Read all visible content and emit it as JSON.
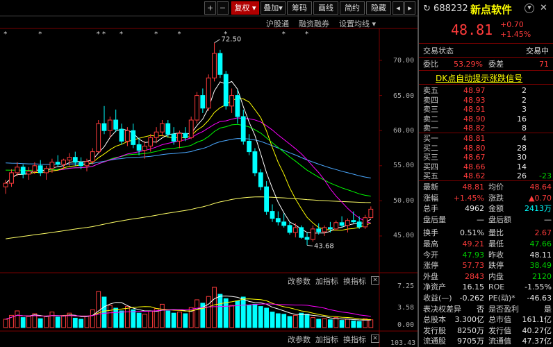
{
  "toolbar": {
    "plus": "+",
    "minus": "−",
    "restore": "复权",
    "overlay": "叠加",
    "chips": "筹码",
    "draw": "画线",
    "brief": "简约",
    "hide": "隐藏",
    "nav_prev": "◂",
    "nav_next": "▸"
  },
  "subtoolbar": {
    "hgt": "沪股通",
    "margin": "融资融券",
    "settings": "设置均线"
  },
  "indicator_bar": {
    "change_params": "改参数",
    "add_indicator": "加指标",
    "switch_indicator": "换指标",
    "close": "✕"
  },
  "chart_data": [
    {
      "type": "candlestick",
      "title": "",
      "ylim": [
        42,
        74
      ],
      "yticks": [
        "70.00",
        "65.00",
        "60.00",
        "55.00",
        "50.00",
        "45.00"
      ],
      "annotations": {
        "high": "72.50",
        "low": "43.68"
      },
      "candles": [
        [
          52.0,
          53.0,
          51.0,
          52.5
        ],
        [
          52.5,
          54.5,
          52.0,
          54.0
        ],
        [
          54.0,
          55.5,
          53.5,
          54.8
        ],
        [
          54.8,
          55.2,
          53.2,
          53.8
        ],
        [
          53.8,
          54.8,
          53.0,
          54.2
        ],
        [
          54.2,
          55.5,
          53.8,
          55.0
        ],
        [
          55.0,
          55.8,
          53.5,
          54.0
        ],
        [
          54.0,
          55.0,
          53.0,
          54.6
        ],
        [
          54.6,
          56.0,
          54.0,
          55.5
        ],
        [
          55.5,
          56.5,
          54.8,
          55.2
        ],
        [
          55.2,
          56.0,
          54.5,
          55.8
        ],
        [
          55.8,
          56.8,
          55.0,
          56.2
        ],
        [
          56.2,
          57.0,
          55.0,
          55.5
        ],
        [
          55.5,
          56.2,
          54.5,
          55.0
        ],
        [
          55.0,
          56.0,
          54.2,
          55.6
        ],
        [
          55.6,
          57.5,
          55.2,
          57.0
        ],
        [
          57.0,
          61.5,
          56.8,
          61.0
        ],
        [
          61.0,
          63.5,
          59.5,
          60.0
        ],
        [
          60.0,
          62.0,
          59.0,
          61.5
        ],
        [
          61.5,
          63.0,
          59.8,
          60.2
        ],
        [
          60.2,
          61.0,
          58.0,
          58.5
        ],
        [
          58.5,
          60.5,
          57.8,
          60.0
        ],
        [
          60.0,
          61.0,
          57.5,
          58.0
        ],
        [
          58.0,
          59.0,
          56.5,
          57.2
        ],
        [
          57.2,
          58.5,
          56.0,
          57.8
        ],
        [
          57.8,
          59.5,
          57.0,
          59.0
        ],
        [
          59.0,
          60.5,
          58.2,
          59.8
        ],
        [
          59.8,
          61.5,
          59.2,
          61.0
        ],
        [
          61.0,
          61.5,
          59.0,
          59.5
        ],
        [
          59.5,
          60.5,
          58.0,
          58.5
        ],
        [
          58.5,
          60.0,
          57.5,
          59.6
        ],
        [
          59.6,
          60.5,
          58.5,
          59.0
        ],
        [
          59.0,
          62.0,
          58.8,
          61.5
        ],
        [
          61.5,
          65.5,
          61.0,
          65.0
        ],
        [
          65.0,
          66.0,
          62.5,
          63.2
        ],
        [
          63.2,
          68.0,
          62.8,
          67.5
        ],
        [
          67.5,
          72.5,
          67.0,
          71.0
        ],
        [
          71.0,
          71.5,
          67.5,
          68.0
        ],
        [
          68.0,
          68.5,
          63.0,
          63.5
        ],
        [
          63.5,
          66.0,
          62.5,
          65.0
        ],
        [
          65.0,
          65.8,
          61.0,
          62.0
        ],
        [
          62.0,
          63.0,
          58.0,
          58.5
        ],
        [
          58.5,
          59.5,
          56.5,
          57.0
        ],
        [
          57.0,
          57.5,
          53.5,
          54.0
        ],
        [
          54.0,
          54.5,
          51.5,
          52.0
        ],
        [
          52.0,
          52.8,
          48.0,
          48.5
        ],
        [
          48.5,
          49.5,
          47.0,
          47.5
        ],
        [
          47.5,
          48.5,
          46.5,
          47.0
        ],
        [
          47.0,
          48.2,
          46.2,
          46.5
        ],
        [
          46.5,
          47.0,
          45.2,
          45.5
        ],
        [
          45.5,
          46.8,
          44.8,
          46.2
        ],
        [
          46.2,
          46.5,
          44.6,
          44.8
        ],
        [
          44.8,
          45.5,
          43.68,
          44.5
        ],
        [
          44.5,
          46.5,
          44.2,
          46.0
        ],
        [
          46.0,
          46.8,
          45.2,
          45.6
        ],
        [
          45.6,
          46.5,
          45.0,
          46.2
        ],
        [
          46.2,
          47.0,
          45.5,
          46.0
        ],
        [
          46.0,
          47.2,
          45.8,
          46.9
        ],
        [
          46.9,
          47.8,
          46.2,
          46.5
        ],
        [
          46.5,
          47.5,
          45.5,
          47.2
        ],
        [
          47.2,
          48.5,
          46.8,
          47.0
        ],
        [
          47.0,
          47.8,
          46.0,
          46.3
        ],
        [
          46.3,
          48.0,
          46.0,
          47.6
        ],
        [
          47.6,
          49.21,
          47.5,
          48.81
        ]
      ],
      "ma_note": "moving averages 5/10/20/60/120/250 computed from candles"
    },
    {
      "type": "bar",
      "title": "volume",
      "yticks": [
        "7.25",
        "3.58",
        "0.00"
      ],
      "values": [
        1.5,
        2.2,
        3.0,
        1.8,
        2.0,
        2.5,
        1.6,
        2.0,
        2.8,
        1.9,
        2.1,
        2.6,
        1.7,
        1.5,
        2.0,
        3.2,
        6.5,
        5.5,
        4.0,
        3.5,
        3.0,
        3.8,
        3.2,
        2.6,
        2.4,
        3.0,
        3.4,
        4.2,
        3.0,
        2.6,
        2.8,
        2.5,
        3.6,
        5.0,
        4.4,
        5.6,
        7.25,
        6.0,
        5.2,
        4.0,
        4.8,
        5.5,
        4.0,
        4.2,
        3.8,
        3.5,
        2.8,
        2.5,
        2.4,
        2.0,
        2.2,
        2.6,
        2.4,
        1.8,
        1.5,
        1.6,
        1.4,
        1.8,
        1.3,
        1.5,
        1.2,
        1.1,
        1.6,
        1.4
      ]
    }
  ],
  "bottom_label": "103.43",
  "quote": {
    "code": "688232",
    "name": "新点软件",
    "price": "48.81",
    "change": "+0.70",
    "pct": "+1.45%",
    "status_label": "交易状态",
    "status_value": "交易中",
    "ratio_label": "委比",
    "ratio_value": "53.29%",
    "diff_label": "委差",
    "diff_value": "71",
    "signal": "DK点自动提示涨跌信号",
    "asks": [
      {
        "label": "卖五",
        "price": "48.97",
        "vol": "2",
        "chg": ""
      },
      {
        "label": "卖四",
        "price": "48.93",
        "vol": "2",
        "chg": ""
      },
      {
        "label": "卖三",
        "price": "48.91",
        "vol": "3",
        "chg": ""
      },
      {
        "label": "卖二",
        "price": "48.90",
        "vol": "16",
        "chg": ""
      },
      {
        "label": "卖一",
        "price": "48.82",
        "vol": "8",
        "chg": ""
      }
    ],
    "bids": [
      {
        "label": "买一",
        "price": "48.81",
        "vol": "4",
        "chg": ""
      },
      {
        "label": "买二",
        "price": "48.80",
        "vol": "28",
        "chg": ""
      },
      {
        "label": "买三",
        "price": "48.67",
        "vol": "30",
        "chg": ""
      },
      {
        "label": "买四",
        "price": "48.66",
        "vol": "14",
        "chg": ""
      },
      {
        "label": "买五",
        "price": "48.62",
        "vol": "26",
        "chg": "-23"
      }
    ],
    "stats": [
      {
        "l1": "最新",
        "v1": "48.81",
        "c1": "red",
        "l2": "均价",
        "v2": "48.64",
        "c2": "red"
      },
      {
        "l1": "涨幅",
        "v1": "+1.45%",
        "c1": "red",
        "l2": "涨跌",
        "v2": "▲0.70",
        "c2": "red"
      },
      {
        "l1": "总手",
        "v1": "4962",
        "c1": "wht",
        "l2": "金额",
        "v2": "2413万",
        "c2": "cyn"
      },
      {
        "l1": "盘后量",
        "v1": "—",
        "c1": "wht",
        "l2": "盘后额",
        "v2": "—",
        "c2": "wht"
      },
      {
        "l1": "换手",
        "v1": "0.51%",
        "c1": "wht",
        "l2": "量比",
        "v2": "2.67",
        "c2": "red"
      },
      {
        "l1": "最高",
        "v1": "49.21",
        "c1": "red",
        "l2": "最低",
        "v2": "47.66",
        "c2": "grn"
      },
      {
        "l1": "今开",
        "v1": "47.93",
        "c1": "grn",
        "l2": "昨收",
        "v2": "48.11",
        "c2": "wht"
      },
      {
        "l1": "涨停",
        "v1": "57.73",
        "c1": "red",
        "l2": "跌停",
        "v2": "38.49",
        "c2": "grn"
      },
      {
        "l1": "外盘",
        "v1": "2843",
        "c1": "red",
        "l2": "内盘",
        "v2": "2120",
        "c2": "grn"
      },
      {
        "l1": "净资产",
        "v1": "16.15",
        "c1": "wht",
        "l2": "ROE",
        "v2": "-1.55%",
        "c2": "wht"
      },
      {
        "l1": "收益(—)",
        "v1": "-0.262",
        "c1": "wht",
        "l2": "PE(动)*",
        "v2": "-46.63",
        "c2": "wht"
      },
      {
        "l1": "表决权差异",
        "v1": "否",
        "c1": "wht",
        "l2": "是否盈利",
        "v2": "是",
        "c2": "wht"
      },
      {
        "l1": "总股本",
        "v1": "3.300亿",
        "c1": "wht",
        "l2": "总市值",
        "v2": "161.1亿",
        "c2": "wht"
      },
      {
        "l1": "发行股",
        "v1": "8250万",
        "c1": "wht",
        "l2": "发行值",
        "v2": "40.27亿",
        "c2": "wht"
      },
      {
        "l1": "流通股",
        "v1": "9705万",
        "c1": "wht",
        "l2": "流通值",
        "v2": "47.37亿",
        "c2": "wht"
      }
    ]
  },
  "colors": {
    "up": "#ff3b3b",
    "down": "#00ffff",
    "ma5": "#ffffff",
    "ma10": "#ffff00",
    "ma20": "#ff00ff",
    "ma60": "#00ff00",
    "ma120": "#4aa8ff",
    "ma250": "#ffff66"
  }
}
